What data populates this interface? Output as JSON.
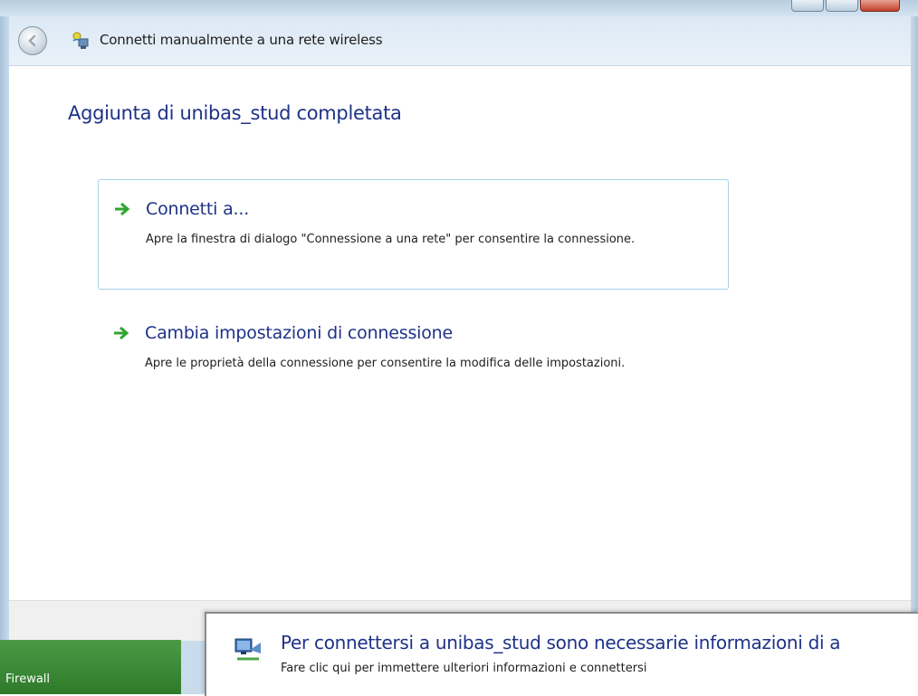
{
  "window": {
    "title": "Connetti manualmente a una rete wireless"
  },
  "main": {
    "heading": "Aggiunta di unibas_stud completata",
    "options": [
      {
        "title": "Connetti a...",
        "description": "Apre la finestra di dialogo \"Connessione a una rete\" per consentire la connessione."
      },
      {
        "title": "Cambia impostazioni di connessione",
        "description": "Apre le proprietà della connessione per consentire la modifica delle impostazioni."
      }
    ]
  },
  "taskbar": {
    "firewall_label": "Firewall"
  },
  "notification": {
    "title": "Per connettersi a unibas_stud sono necessarie informazioni di a",
    "text": "Fare clic qui per immettere ulteriori informazioni e connettersi"
  },
  "colors": {
    "heading": "#1e3287",
    "arrow": "#2ea52e",
    "focus_border": "#a6d0ea"
  }
}
